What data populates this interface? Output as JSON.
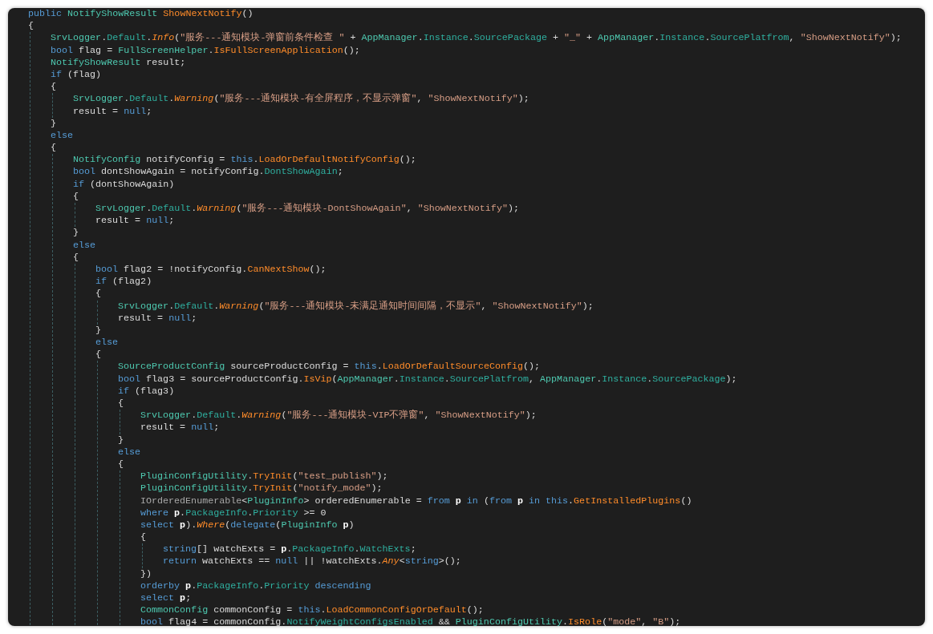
{
  "code_lines": [
    {
      "tokens": [
        {
          "kind": "keyword",
          "text": "public "
        },
        {
          "kind": "type",
          "text": "NotifyShowResult "
        },
        {
          "kind": "method",
          "text": "ShowNextNotify"
        },
        {
          "kind": "plain",
          "text": "()"
        }
      ]
    },
    {
      "tokens": [
        {
          "kind": "plain",
          "text": "{"
        }
      ],
      "children": [
        {
          "tokens": [
            {
              "kind": "type",
              "text": "SrvLogger"
            },
            {
              "kind": "plain",
              "text": "."
            },
            {
              "kind": "member",
              "text": "Default"
            },
            {
              "kind": "plain",
              "text": "."
            },
            {
              "kind": "method_italic",
              "text": "Info"
            },
            {
              "kind": "plain",
              "text": "("
            },
            {
              "kind": "string",
              "text": "\"服务---通知模块-弹窗前条件检查 \""
            },
            {
              "kind": "plain",
              "text": " + "
            },
            {
              "kind": "type",
              "text": "AppManager"
            },
            {
              "kind": "plain",
              "text": "."
            },
            {
              "kind": "member",
              "text": "Instance"
            },
            {
              "kind": "plain",
              "text": "."
            },
            {
              "kind": "member",
              "text": "SourcePackage"
            },
            {
              "kind": "plain",
              "text": " + "
            },
            {
              "kind": "string",
              "text": "\"_\""
            },
            {
              "kind": "plain",
              "text": " + "
            },
            {
              "kind": "type",
              "text": "AppManager"
            },
            {
              "kind": "plain",
              "text": "."
            },
            {
              "kind": "member",
              "text": "Instance"
            },
            {
              "kind": "plain",
              "text": "."
            },
            {
              "kind": "member",
              "text": "SourcePlatfrom"
            },
            {
              "kind": "plain",
              "text": ", "
            },
            {
              "kind": "string",
              "text": "\"ShowNextNotify\""
            },
            {
              "kind": "plain",
              "text": ");"
            }
          ]
        },
        {
          "tokens": [
            {
              "kind": "keyword",
              "text": "bool "
            },
            {
              "kind": "plain",
              "text": "flag = "
            },
            {
              "kind": "type",
              "text": "FullScreenHelper"
            },
            {
              "kind": "plain",
              "text": "."
            },
            {
              "kind": "method",
              "text": "IsFullScreenApplication"
            },
            {
              "kind": "plain",
              "text": "();"
            }
          ]
        },
        {
          "tokens": [
            {
              "kind": "type",
              "text": "NotifyShowResult "
            },
            {
              "kind": "plain",
              "text": "result;"
            }
          ]
        },
        {
          "tokens": [
            {
              "kind": "keyword",
              "text": "if "
            },
            {
              "kind": "plain",
              "text": "(flag)"
            }
          ]
        },
        {
          "tokens": [
            {
              "kind": "plain",
              "text": "{"
            }
          ],
          "children": [
            {
              "tokens": [
                {
                  "kind": "type",
                  "text": "SrvLogger"
                },
                {
                  "kind": "plain",
                  "text": "."
                },
                {
                  "kind": "member",
                  "text": "Default"
                },
                {
                  "kind": "plain",
                  "text": "."
                },
                {
                  "kind": "method_italic",
                  "text": "Warning"
                },
                {
                  "kind": "plain",
                  "text": "("
                },
                {
                  "kind": "string",
                  "text": "\"服务---通知模块-有全屏程序，不显示弹窗\""
                },
                {
                  "kind": "plain",
                  "text": ", "
                },
                {
                  "kind": "string",
                  "text": "\"ShowNextNotify\""
                },
                {
                  "kind": "plain",
                  "text": ");"
                }
              ]
            },
            {
              "tokens": [
                {
                  "kind": "plain",
                  "text": "result = "
                },
                {
                  "kind": "keyword",
                  "text": "null"
                },
                {
                  "kind": "plain",
                  "text": ";"
                }
              ]
            }
          ]
        },
        {
          "tokens": [
            {
              "kind": "plain",
              "text": "}"
            }
          ]
        },
        {
          "tokens": [
            {
              "kind": "keyword",
              "text": "else"
            }
          ]
        },
        {
          "tokens": [
            {
              "kind": "plain",
              "text": "{"
            }
          ],
          "children": [
            {
              "tokens": [
                {
                  "kind": "type",
                  "text": "NotifyConfig "
                },
                {
                  "kind": "plain",
                  "text": "notifyConfig = "
                },
                {
                  "kind": "keyword",
                  "text": "this"
                },
                {
                  "kind": "plain",
                  "text": "."
                },
                {
                  "kind": "method",
                  "text": "LoadOrDefaultNotifyConfig"
                },
                {
                  "kind": "plain",
                  "text": "();"
                }
              ]
            },
            {
              "tokens": [
                {
                  "kind": "keyword",
                  "text": "bool "
                },
                {
                  "kind": "plain",
                  "text": "dontShowAgain = notifyConfig."
                },
                {
                  "kind": "member",
                  "text": "DontShowAgain"
                },
                {
                  "kind": "plain",
                  "text": ";"
                }
              ]
            },
            {
              "tokens": [
                {
                  "kind": "keyword",
                  "text": "if "
                },
                {
                  "kind": "plain",
                  "text": "(dontShowAgain)"
                }
              ]
            },
            {
              "tokens": [
                {
                  "kind": "plain",
                  "text": "{"
                }
              ],
              "children": [
                {
                  "tokens": [
                    {
                      "kind": "type",
                      "text": "SrvLogger"
                    },
                    {
                      "kind": "plain",
                      "text": "."
                    },
                    {
                      "kind": "member",
                      "text": "Default"
                    },
                    {
                      "kind": "plain",
                      "text": "."
                    },
                    {
                      "kind": "method_italic",
                      "text": "Warning"
                    },
                    {
                      "kind": "plain",
                      "text": "("
                    },
                    {
                      "kind": "string",
                      "text": "\"服务---通知模块-DontShowAgain\""
                    },
                    {
                      "kind": "plain",
                      "text": ", "
                    },
                    {
                      "kind": "string",
                      "text": "\"ShowNextNotify\""
                    },
                    {
                      "kind": "plain",
                      "text": ");"
                    }
                  ]
                },
                {
                  "tokens": [
                    {
                      "kind": "plain",
                      "text": "result = "
                    },
                    {
                      "kind": "keyword",
                      "text": "null"
                    },
                    {
                      "kind": "plain",
                      "text": ";"
                    }
                  ]
                }
              ]
            },
            {
              "tokens": [
                {
                  "kind": "plain",
                  "text": "}"
                }
              ]
            },
            {
              "tokens": [
                {
                  "kind": "keyword",
                  "text": "else"
                }
              ]
            },
            {
              "tokens": [
                {
                  "kind": "plain",
                  "text": "{"
                }
              ],
              "children": [
                {
                  "tokens": [
                    {
                      "kind": "keyword",
                      "text": "bool "
                    },
                    {
                      "kind": "plain",
                      "text": "flag2 = !notifyConfig."
                    },
                    {
                      "kind": "method",
                      "text": "CanNextShow"
                    },
                    {
                      "kind": "plain",
                      "text": "();"
                    }
                  ]
                },
                {
                  "tokens": [
                    {
                      "kind": "keyword",
                      "text": "if "
                    },
                    {
                      "kind": "plain",
                      "text": "(flag2)"
                    }
                  ]
                },
                {
                  "tokens": [
                    {
                      "kind": "plain",
                      "text": "{"
                    }
                  ],
                  "children": [
                    {
                      "tokens": [
                        {
                          "kind": "type",
                          "text": "SrvLogger"
                        },
                        {
                          "kind": "plain",
                          "text": "."
                        },
                        {
                          "kind": "member",
                          "text": "Default"
                        },
                        {
                          "kind": "plain",
                          "text": "."
                        },
                        {
                          "kind": "method_italic",
                          "text": "Warning"
                        },
                        {
                          "kind": "plain",
                          "text": "("
                        },
                        {
                          "kind": "string",
                          "text": "\"服务---通知模块-未满足通知时间间隔，不显示\""
                        },
                        {
                          "kind": "plain",
                          "text": ", "
                        },
                        {
                          "kind": "string",
                          "text": "\"ShowNextNotify\""
                        },
                        {
                          "kind": "plain",
                          "text": ");"
                        }
                      ]
                    },
                    {
                      "tokens": [
                        {
                          "kind": "plain",
                          "text": "result = "
                        },
                        {
                          "kind": "keyword",
                          "text": "null"
                        },
                        {
                          "kind": "plain",
                          "text": ";"
                        }
                      ]
                    }
                  ]
                },
                {
                  "tokens": [
                    {
                      "kind": "plain",
                      "text": "}"
                    }
                  ]
                },
                {
                  "tokens": [
                    {
                      "kind": "keyword",
                      "text": "else"
                    }
                  ]
                },
                {
                  "tokens": [
                    {
                      "kind": "plain",
                      "text": "{"
                    }
                  ],
                  "children": [
                    {
                      "tokens": [
                        {
                          "kind": "type",
                          "text": "SourceProductConfig "
                        },
                        {
                          "kind": "plain",
                          "text": "sourceProductConfig = "
                        },
                        {
                          "kind": "keyword",
                          "text": "this"
                        },
                        {
                          "kind": "plain",
                          "text": "."
                        },
                        {
                          "kind": "method",
                          "text": "LoadOrDefaultSourceConfig"
                        },
                        {
                          "kind": "plain",
                          "text": "();"
                        }
                      ]
                    },
                    {
                      "tokens": [
                        {
                          "kind": "keyword",
                          "text": "bool "
                        },
                        {
                          "kind": "plain",
                          "text": "flag3 = sourceProductConfig."
                        },
                        {
                          "kind": "method",
                          "text": "IsVip"
                        },
                        {
                          "kind": "plain",
                          "text": "("
                        },
                        {
                          "kind": "type",
                          "text": "AppManager"
                        },
                        {
                          "kind": "plain",
                          "text": "."
                        },
                        {
                          "kind": "member",
                          "text": "Instance"
                        },
                        {
                          "kind": "plain",
                          "text": "."
                        },
                        {
                          "kind": "member",
                          "text": "SourcePlatfrom"
                        },
                        {
                          "kind": "plain",
                          "text": ", "
                        },
                        {
                          "kind": "type",
                          "text": "AppManager"
                        },
                        {
                          "kind": "plain",
                          "text": "."
                        },
                        {
                          "kind": "member",
                          "text": "Instance"
                        },
                        {
                          "kind": "plain",
                          "text": "."
                        },
                        {
                          "kind": "member",
                          "text": "SourcePackage"
                        },
                        {
                          "kind": "plain",
                          "text": ");"
                        }
                      ]
                    },
                    {
                      "tokens": [
                        {
                          "kind": "keyword",
                          "text": "if "
                        },
                        {
                          "kind": "plain",
                          "text": "(flag3)"
                        }
                      ]
                    },
                    {
                      "tokens": [
                        {
                          "kind": "plain",
                          "text": "{"
                        }
                      ],
                      "children": [
                        {
                          "tokens": [
                            {
                              "kind": "type",
                              "text": "SrvLogger"
                            },
                            {
                              "kind": "plain",
                              "text": "."
                            },
                            {
                              "kind": "member",
                              "text": "Default"
                            },
                            {
                              "kind": "plain",
                              "text": "."
                            },
                            {
                              "kind": "method_italic",
                              "text": "Warning"
                            },
                            {
                              "kind": "plain",
                              "text": "("
                            },
                            {
                              "kind": "string",
                              "text": "\"服务---通知模块-VIP不弹窗\""
                            },
                            {
                              "kind": "plain",
                              "text": ", "
                            },
                            {
                              "kind": "string",
                              "text": "\"ShowNextNotify\""
                            },
                            {
                              "kind": "plain",
                              "text": ");"
                            }
                          ]
                        },
                        {
                          "tokens": [
                            {
                              "kind": "plain",
                              "text": "result = "
                            },
                            {
                              "kind": "keyword",
                              "text": "null"
                            },
                            {
                              "kind": "plain",
                              "text": ";"
                            }
                          ]
                        }
                      ]
                    },
                    {
                      "tokens": [
                        {
                          "kind": "plain",
                          "text": "}"
                        }
                      ]
                    },
                    {
                      "tokens": [
                        {
                          "kind": "keyword",
                          "text": "else"
                        }
                      ]
                    },
                    {
                      "tokens": [
                        {
                          "kind": "plain",
                          "text": "{"
                        }
                      ],
                      "children": [
                        {
                          "tokens": [
                            {
                              "kind": "type",
                              "text": "PluginConfigUtility"
                            },
                            {
                              "kind": "plain",
                              "text": "."
                            },
                            {
                              "kind": "method",
                              "text": "TryInit"
                            },
                            {
                              "kind": "plain",
                              "text": "("
                            },
                            {
                              "kind": "string",
                              "text": "\"test_publish\""
                            },
                            {
                              "kind": "plain",
                              "text": ");"
                            }
                          ]
                        },
                        {
                          "tokens": [
                            {
                              "kind": "type",
                              "text": "PluginConfigUtility"
                            },
                            {
                              "kind": "plain",
                              "text": "."
                            },
                            {
                              "kind": "method",
                              "text": "TryInit"
                            },
                            {
                              "kind": "plain",
                              "text": "("
                            },
                            {
                              "kind": "string",
                              "text": "\"notify_mode\""
                            },
                            {
                              "kind": "plain",
                              "text": ");"
                            }
                          ]
                        },
                        {
                          "tokens": [
                            {
                              "kind": "interface",
                              "text": "IOrderedEnumerable"
                            },
                            {
                              "kind": "plain",
                              "text": "<"
                            },
                            {
                              "kind": "type",
                              "text": "PluginInfo"
                            },
                            {
                              "kind": "plain",
                              "text": "> orderedEnumerable = "
                            },
                            {
                              "kind": "keyword",
                              "text": "from "
                            },
                            {
                              "kind": "range_var",
                              "text": "p"
                            },
                            {
                              "kind": "keyword",
                              "text": " in "
                            },
                            {
                              "kind": "plain",
                              "text": "("
                            },
                            {
                              "kind": "keyword",
                              "text": "from "
                            },
                            {
                              "kind": "range_var",
                              "text": "p"
                            },
                            {
                              "kind": "keyword",
                              "text": " in this"
                            },
                            {
                              "kind": "plain",
                              "text": "."
                            },
                            {
                              "kind": "method",
                              "text": "GetInstalledPlugins"
                            },
                            {
                              "kind": "plain",
                              "text": "()"
                            }
                          ]
                        },
                        {
                          "tokens": [
                            {
                              "kind": "keyword",
                              "text": "where "
                            },
                            {
                              "kind": "range_var",
                              "text": "p"
                            },
                            {
                              "kind": "plain",
                              "text": "."
                            },
                            {
                              "kind": "member",
                              "text": "PackageInfo"
                            },
                            {
                              "kind": "plain",
                              "text": "."
                            },
                            {
                              "kind": "member",
                              "text": "Priority"
                            },
                            {
                              "kind": "plain",
                              "text": " >= 0"
                            }
                          ]
                        },
                        {
                          "tokens": [
                            {
                              "kind": "keyword",
                              "text": "select "
                            },
                            {
                              "kind": "range_var",
                              "text": "p"
                            },
                            {
                              "kind": "plain",
                              "text": ")."
                            },
                            {
                              "kind": "method_italic",
                              "text": "Where"
                            },
                            {
                              "kind": "plain",
                              "text": "("
                            },
                            {
                              "kind": "keyword",
                              "text": "delegate"
                            },
                            {
                              "kind": "plain",
                              "text": "("
                            },
                            {
                              "kind": "type",
                              "text": "PluginInfo "
                            },
                            {
                              "kind": "range_var",
                              "text": "p"
                            },
                            {
                              "kind": "plain",
                              "text": ")"
                            }
                          ]
                        },
                        {
                          "tokens": [
                            {
                              "kind": "plain",
                              "text": "{"
                            }
                          ],
                          "children": [
                            {
                              "tokens": [
                                {
                                  "kind": "keyword",
                                  "text": "string"
                                },
                                {
                                  "kind": "plain",
                                  "text": "[] watchExts = "
                                },
                                {
                                  "kind": "range_var",
                                  "text": "p"
                                },
                                {
                                  "kind": "plain",
                                  "text": "."
                                },
                                {
                                  "kind": "member",
                                  "text": "PackageInfo"
                                },
                                {
                                  "kind": "plain",
                                  "text": "."
                                },
                                {
                                  "kind": "member",
                                  "text": "WatchExts"
                                },
                                {
                                  "kind": "plain",
                                  "text": ";"
                                }
                              ]
                            },
                            {
                              "tokens": [
                                {
                                  "kind": "keyword",
                                  "text": "return "
                                },
                                {
                                  "kind": "plain",
                                  "text": "watchExts == "
                                },
                                {
                                  "kind": "keyword",
                                  "text": "null"
                                },
                                {
                                  "kind": "plain",
                                  "text": " || !watchExts."
                                },
                                {
                                  "kind": "method_italic",
                                  "text": "Any"
                                },
                                {
                                  "kind": "plain",
                                  "text": "<"
                                },
                                {
                                  "kind": "keyword",
                                  "text": "string"
                                },
                                {
                                  "kind": "plain",
                                  "text": ">();"
                                }
                              ]
                            }
                          ]
                        },
                        {
                          "tokens": [
                            {
                              "kind": "plain",
                              "text": "})"
                            }
                          ]
                        },
                        {
                          "tokens": [
                            {
                              "kind": "keyword",
                              "text": "orderby "
                            },
                            {
                              "kind": "range_var",
                              "text": "p"
                            },
                            {
                              "kind": "plain",
                              "text": "."
                            },
                            {
                              "kind": "member",
                              "text": "PackageInfo"
                            },
                            {
                              "kind": "plain",
                              "text": "."
                            },
                            {
                              "kind": "member",
                              "text": "Priority"
                            },
                            {
                              "kind": "keyword",
                              "text": " descending"
                            }
                          ]
                        },
                        {
                          "tokens": [
                            {
                              "kind": "keyword",
                              "text": "select "
                            },
                            {
                              "kind": "range_var",
                              "text": "p"
                            },
                            {
                              "kind": "plain",
                              "text": ";"
                            }
                          ]
                        },
                        {
                          "tokens": [
                            {
                              "kind": "type",
                              "text": "CommonConfig "
                            },
                            {
                              "kind": "plain",
                              "text": "commonConfig = "
                            },
                            {
                              "kind": "keyword",
                              "text": "this"
                            },
                            {
                              "kind": "plain",
                              "text": "."
                            },
                            {
                              "kind": "method",
                              "text": "LoadCommonConfigOrDefault"
                            },
                            {
                              "kind": "plain",
                              "text": "();"
                            }
                          ]
                        },
                        {
                          "tokens": [
                            {
                              "kind": "keyword",
                              "text": "bool "
                            },
                            {
                              "kind": "plain",
                              "text": "flag4 = commonConfig."
                            },
                            {
                              "kind": "member",
                              "text": "NotifyWeightConfigsEnabled"
                            },
                            {
                              "kind": "plain",
                              "text": " && "
                            },
                            {
                              "kind": "type",
                              "text": "PluginConfigUtility"
                            },
                            {
                              "kind": "plain",
                              "text": "."
                            },
                            {
                              "kind": "method",
                              "text": "IsRole"
                            },
                            {
                              "kind": "plain",
                              "text": "("
                            },
                            {
                              "kind": "string",
                              "text": "\"mode\""
                            },
                            {
                              "kind": "plain",
                              "text": ", "
                            },
                            {
                              "kind": "string",
                              "text": "\"B\""
                            },
                            {
                              "kind": "plain",
                              "text": ");"
                            }
                          ]
                        }
                      ]
                    }
                  ]
                }
              ]
            }
          ]
        }
      ]
    }
  ]
}
